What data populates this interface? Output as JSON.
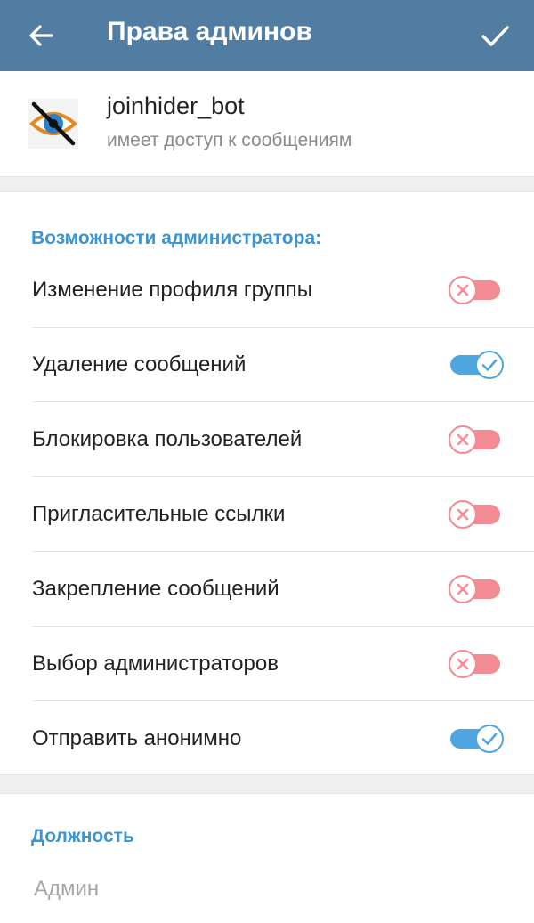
{
  "header": {
    "title": "Права админов"
  },
  "bot": {
    "name": "joinhider_bot",
    "status": "имеет доступ к сообщениям"
  },
  "permissions": {
    "section_title": "Возможности администратора:",
    "items": [
      {
        "label": "Изменение профиля группы",
        "enabled": false
      },
      {
        "label": "Удаление сообщений",
        "enabled": true
      },
      {
        "label": "Блокировка пользователей",
        "enabled": false
      },
      {
        "label": "Пригласительные ссылки",
        "enabled": false
      },
      {
        "label": "Закрепление сообщений",
        "enabled": false
      },
      {
        "label": "Выбор администраторов",
        "enabled": false
      },
      {
        "label": "Отправить анонимно",
        "enabled": true
      }
    ]
  },
  "rank": {
    "section_title": "Должность",
    "placeholder": "Админ"
  },
  "colors": {
    "header_bg": "#527da3",
    "accent": "#3a95d5",
    "switch_on": "#4fa5e0",
    "switch_off": "#f28b93"
  }
}
